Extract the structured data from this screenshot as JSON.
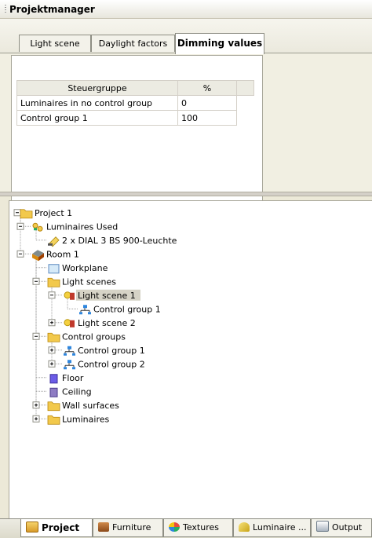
{
  "window": {
    "title": "Projektmanager"
  },
  "tabs": [
    "Light scene",
    "Daylight factors",
    "Dimming values"
  ],
  "active_tab": "Dimming values",
  "dimming_table": {
    "headers": [
      "Steuergruppe",
      "%"
    ],
    "rows": [
      [
        "Luminaires in no control group",
        "0"
      ],
      [
        "Control group 1",
        "100"
      ]
    ]
  },
  "tree": [
    {
      "label": "Project 1",
      "icon": "folder-icon",
      "depth": 0,
      "toggle": "minus"
    },
    {
      "label": "Luminaires Used",
      "icon": "luminaires-used-icon",
      "depth": 1,
      "toggle": "minus"
    },
    {
      "label": "2 x DIAL 3 BS 900-Leuchte",
      "icon": "luminaire-icon",
      "depth": 2,
      "toggle": "none"
    },
    {
      "label": "Room 1",
      "icon": "room-icon",
      "depth": 1,
      "toggle": "minus"
    },
    {
      "label": "Workplane",
      "icon": "workplane-icon",
      "depth": 2,
      "toggle": "none"
    },
    {
      "label": "Light scenes",
      "icon": "folder-icon",
      "depth": 2,
      "toggle": "minus"
    },
    {
      "label": "Light scene 1",
      "icon": "light-scene-icon",
      "depth": 3,
      "toggle": "minus",
      "selected": true
    },
    {
      "label": "Control group 1",
      "icon": "control-group-icon",
      "depth": 4,
      "toggle": "none"
    },
    {
      "label": "Light scene 2",
      "icon": "light-scene-icon",
      "depth": 3,
      "toggle": "plus"
    },
    {
      "label": "Control groups",
      "icon": "folder-icon",
      "depth": 2,
      "toggle": "minus"
    },
    {
      "label": "Control group 1",
      "icon": "control-group-icon",
      "depth": 3,
      "toggle": "plus"
    },
    {
      "label": "Control group 2",
      "icon": "control-group-icon",
      "depth": 3,
      "toggle": "plus"
    },
    {
      "label": "Floor",
      "icon": "floor-icon",
      "depth": 2,
      "toggle": "none"
    },
    {
      "label": "Ceiling",
      "icon": "ceiling-icon",
      "depth": 2,
      "toggle": "none"
    },
    {
      "label": "Wall surfaces",
      "icon": "folder-icon",
      "depth": 2,
      "toggle": "plus"
    },
    {
      "label": "Luminaires",
      "icon": "folder-icon",
      "depth": 2,
      "toggle": "plus"
    }
  ],
  "bottom_tabs": [
    {
      "label": "Project",
      "icon": "project-icon",
      "active": true
    },
    {
      "label": "Furniture",
      "icon": "furniture-icon"
    },
    {
      "label": "Textures",
      "icon": "textures-icon"
    },
    {
      "label": "Luminaire ...",
      "icon": "luminaire-icon"
    },
    {
      "label": "Output",
      "icon": "output-icon"
    }
  ],
  "colors": {
    "folder": "#f2c94c",
    "selection": "#d6d3c6",
    "accent_red": "#c0392b"
  }
}
